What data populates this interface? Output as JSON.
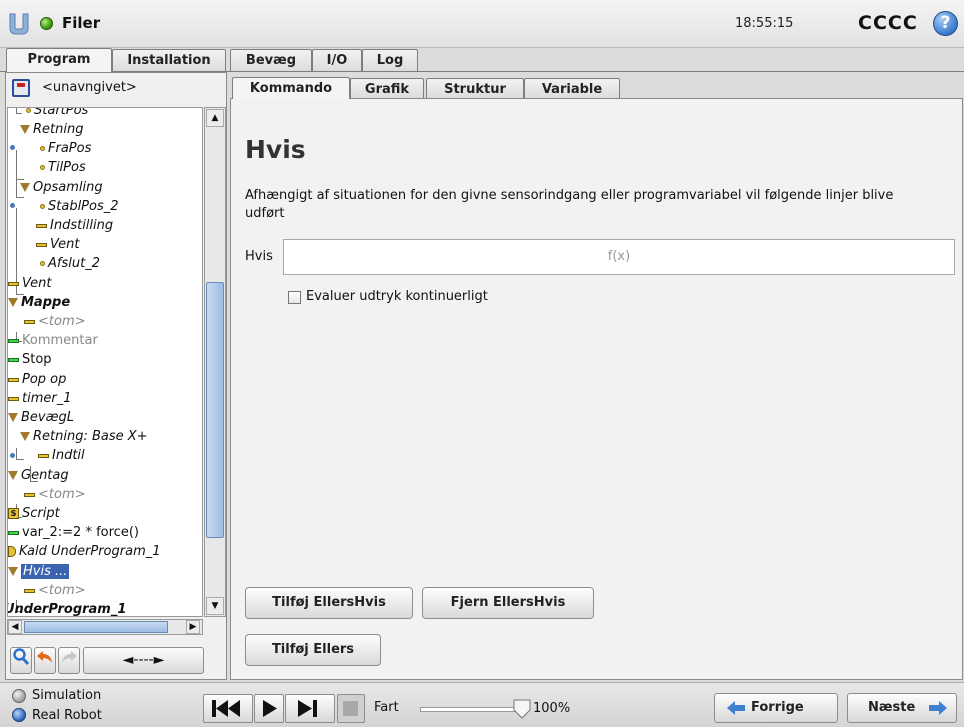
{
  "topbar": {
    "title": "Filer",
    "time": "18:55:15",
    "robot_name": "CCCC",
    "help_symbol": "?"
  },
  "main_tabs": [
    {
      "label": "Program",
      "active": true
    },
    {
      "label": "Installation",
      "active": false
    },
    {
      "label": "Bevæg",
      "active": false
    },
    {
      "label": "I/O",
      "active": false
    },
    {
      "label": "Log",
      "active": false
    }
  ],
  "program": {
    "name": "<unavngivet>"
  },
  "sub_tabs": [
    {
      "label": "Kommando",
      "active": true
    },
    {
      "label": "Grafik",
      "active": false
    },
    {
      "label": "Struktur",
      "active": false
    },
    {
      "label": "Variable",
      "active": false
    }
  ],
  "tree": [
    {
      "label": "StartPos"
    },
    {
      "label": "Retning"
    },
    {
      "label": "FraPos"
    },
    {
      "label": "TilPos"
    },
    {
      "label": "Opsamling"
    },
    {
      "label": "StablPos_2"
    },
    {
      "label": "Indstilling"
    },
    {
      "label": "Vent"
    },
    {
      "label": "Afslut_2"
    },
    {
      "label": "Vent"
    },
    {
      "label": "Mappe"
    },
    {
      "label": "<tom>"
    },
    {
      "label": "Kommentar"
    },
    {
      "label": "Stop"
    },
    {
      "label": "Pop op"
    },
    {
      "label": "timer_1"
    },
    {
      "label": "BevægL"
    },
    {
      "label": "Retning: Base X+"
    },
    {
      "label": "Indtil"
    },
    {
      "label": "Gentag"
    },
    {
      "label": "<tom>"
    },
    {
      "label": "Script"
    },
    {
      "label": "var_2:=2 * force()"
    },
    {
      "label": "Kald UnderProgram_1"
    },
    {
      "label": "Hvis ..."
    },
    {
      "label": "<tom>"
    },
    {
      "label": "UnderProgram_1"
    }
  ],
  "toolbar": {
    "search_icon": "magnifier",
    "undo_icon": "undo-arrow",
    "redo_icon": "redo-arrow",
    "move_label": "◄----►"
  },
  "command": {
    "heading": "Hvis",
    "description": "Afhængigt af situationen for den givne sensorindgang eller programvariabel vil følgende linjer blive udført",
    "field_label": "Hvis",
    "expression_placeholder": "f(x)",
    "checkbox_label": "Evaluer udtryk kontinuerligt",
    "checkbox_checked": false,
    "add_elseif_label": "Tilføj EllersHvis",
    "remove_elseif_label": "Fjern EllersHvis",
    "add_else_label": "Tilføj Ellers"
  },
  "bottombar": {
    "simulation_label": "Simulation",
    "real_robot_label": "Real Robot",
    "speed_label": "Fart",
    "speed_value": "100%",
    "speed_fraction": 1.0,
    "prev_label": "Forrige",
    "next_label": "Næste"
  },
  "colors": {
    "selection": "#3a63b0",
    "accent_blue": "#3f7fd0",
    "waypoint": "#e7c230",
    "command_green": "#3dd94a"
  }
}
